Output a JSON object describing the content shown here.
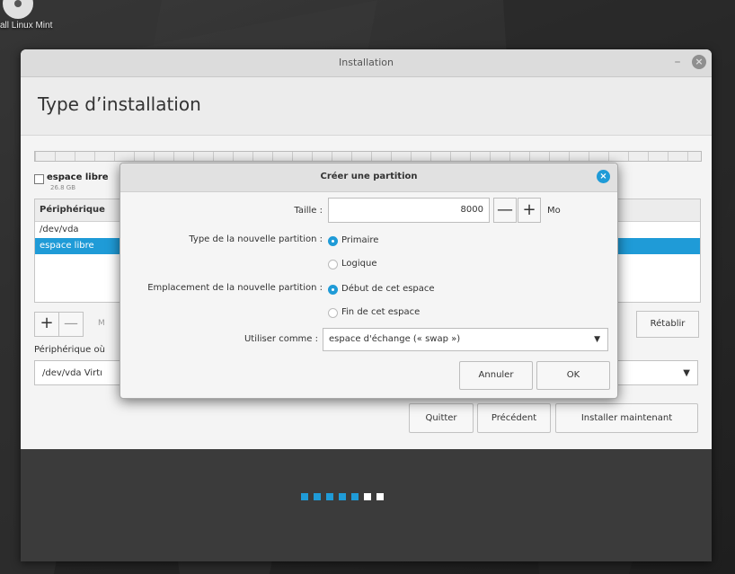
{
  "desktop": {
    "icon_label": "all Linux Mint"
  },
  "window": {
    "title": "Installation",
    "minimize_symbol": "–",
    "close_symbol": "×"
  },
  "page": {
    "title": "Type d’installation"
  },
  "disk": {
    "free_label": "espace libre",
    "free_size": "26.8 GB"
  },
  "partition_table": {
    "header": "Périphérique",
    "rows": [
      {
        "label": "/dev/vda",
        "selected": false
      },
      {
        "label": "espace libre",
        "selected": true
      }
    ]
  },
  "table_toolbar": {
    "add_symbol": "+",
    "remove_symbol": "—",
    "change_fragment": "M",
    "reset_label": "Rétablir"
  },
  "bootloader": {
    "label": "Périphérique où",
    "value": "/dev/vda Virtı"
  },
  "nav": {
    "quit": "Quitter",
    "previous": "Précédent",
    "install": "Installer maintenant"
  },
  "slideshow": {
    "dots": [
      {
        "color": "#1f9bd7"
      },
      {
        "color": "#1f9bd7"
      },
      {
        "color": "#1f9bd7"
      },
      {
        "color": "#1f9bd7"
      },
      {
        "color": "#1f9bd7"
      },
      {
        "color": "#ffffff"
      },
      {
        "color": "#ffffff"
      }
    ]
  },
  "dialog": {
    "title": "Créer une partition",
    "close_symbol": "×",
    "size_label": "Taille :",
    "size_value": "8000",
    "size_minus": "—",
    "size_plus": "+",
    "size_unit": "Mo",
    "type_label": "Type de la nouvelle partition :",
    "type_options": [
      "Primaire",
      "Logique"
    ],
    "location_label": "Emplacement de la nouvelle partition :",
    "location_options": [
      "Début de cet espace",
      "Fin de cet espace"
    ],
    "use_label": "Utiliser comme :",
    "use_value": "espace d'échange (« swap »)",
    "cancel": "Annuler",
    "ok": "OK"
  },
  "colors": {
    "accent": "#1f9bd7"
  }
}
